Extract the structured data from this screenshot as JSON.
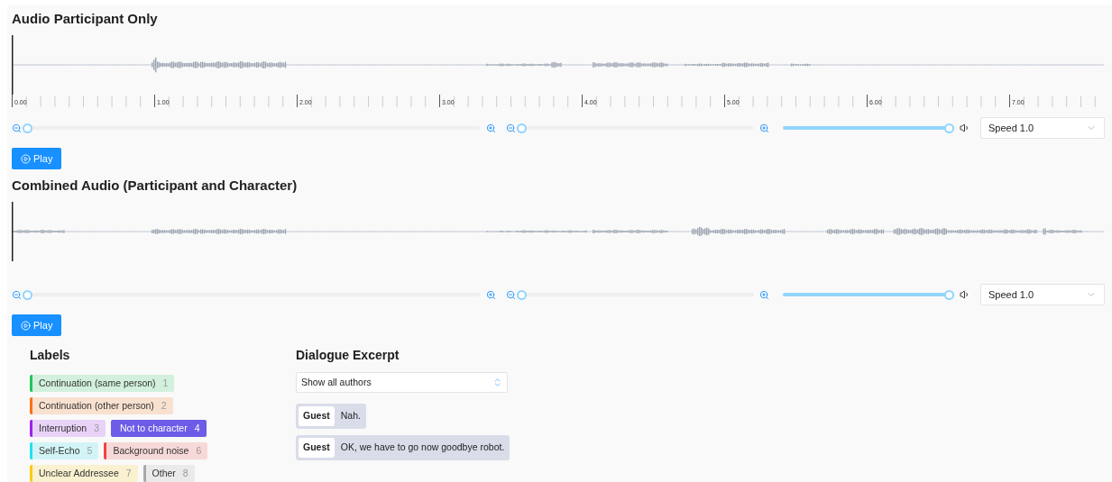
{
  "audio_sections": [
    {
      "title": "Audio Participant Only",
      "kind": "participant",
      "timeline": {
        "labels": [
          "0.00",
          "1.00",
          "2.00",
          "3.00",
          "4.00",
          "5.00",
          "6.00",
          "7.00"
        ]
      },
      "zoom_sliders": [
        {
          "level": 0
        },
        {
          "level": 0
        }
      ],
      "volume": {
        "level": 1
      },
      "speed": {
        "value": "Speed 1.0"
      },
      "play_button": "Play"
    },
    {
      "title": "Combined Audio (Participant and Character)",
      "kind": "combined",
      "zoom_sliders": [
        {
          "level": 0
        },
        {
          "level": 0
        }
      ],
      "volume": {
        "level": 1
      },
      "speed": {
        "value": "Speed 1.0"
      },
      "play_button": "Play"
    }
  ],
  "labels": {
    "title": "Labels",
    "items": [
      {
        "name": "Continuation (same person)",
        "key": "1",
        "color": "#22c55e",
        "selected": false
      },
      {
        "name": "Continuation (other person)",
        "key": "2",
        "color": "#f97316",
        "selected": false
      },
      {
        "name": "Interruption",
        "key": "3",
        "color": "#a020f0",
        "selected": false
      },
      {
        "name": "Not to character",
        "key": "4",
        "color": "#6c5ce7",
        "selected": true
      },
      {
        "name": "Self-Echo",
        "key": "5",
        "color": "#22e0f0",
        "selected": false
      },
      {
        "name": "Background noise",
        "key": "6",
        "color": "#ef4444",
        "selected": false
      },
      {
        "name": "Unclear Addressee",
        "key": "7",
        "color": "#facc15",
        "selected": false
      },
      {
        "name": "Other",
        "key": "8",
        "color": "#a8a8a8",
        "selected": false
      }
    ]
  },
  "dialogue": {
    "title": "Dialogue Excerpt",
    "author_filter": {
      "value": "Show all authors"
    },
    "messages": [
      {
        "author": "Guest",
        "text": "Nah."
      },
      {
        "author": "Guest",
        "text": "OK, we have to go now goodbye robot."
      }
    ]
  }
}
